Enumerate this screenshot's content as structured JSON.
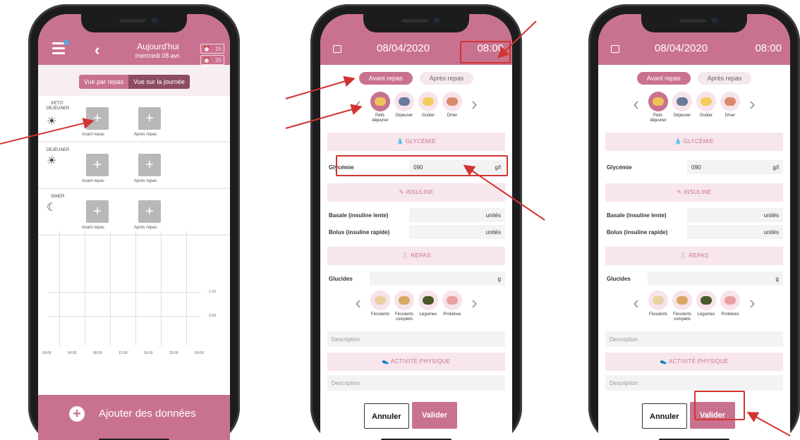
{
  "screen1": {
    "header": {
      "title": "Aujourd'hui",
      "subtitle": "mercredi 08 avr.",
      "alarm1": "1h",
      "alarm2": "2h"
    },
    "view_toggle": {
      "per_meal": "Vue par repas",
      "day": "Vue sur la journée"
    },
    "meals": [
      {
        "label": "PETIT-DEJEUNER",
        "icon": "sunrise-icon",
        "before": "Avant repas",
        "after": "Après repas"
      },
      {
        "label": "DEJEUNER",
        "icon": "sun-icon",
        "before": "Avant repas",
        "after": "Après repas"
      },
      {
        "label": "DINER",
        "icon": "moon-icon",
        "before": "Avant repas",
        "after": "Après repas"
      }
    ],
    "chart": {
      "y_ticks": [
        "1,10",
        "0,59"
      ],
      "x_ticks": [
        "00:00",
        "04:00",
        "08:00",
        "12:00",
        "16:00",
        "20:00",
        "00:00"
      ]
    },
    "add_button": "Ajouter des données"
  },
  "form": {
    "date": "08/04/2020",
    "time": "08:00",
    "tab_before": "Avant repas",
    "tab_after": "Après repas",
    "meals": [
      "Petit-déjeuner",
      "Déjeuner",
      "Goûter",
      "Dîner"
    ],
    "glycemia_section": "GLYCÉMIE",
    "glycemia_label": "Glycémie",
    "glycemia_value": "090",
    "glycemia_unit": "g/l",
    "insulin_section": "INSULINE",
    "basal_label": "Basale (insuline lente)",
    "bolus_label": "Bolus (insuline rapide)",
    "unit_units": "unités",
    "meal_section": "REPAS",
    "carbs_label": "Glucides",
    "carbs_unit": "g",
    "foods": [
      "Féculents",
      "Féculents complets",
      "Légumes",
      "Protéines"
    ],
    "description_placeholder": "Description",
    "activity_section": "ACTIVITÉ PHYSIQUE",
    "cancel": "Annuler",
    "validate": "Valider"
  },
  "colors": {
    "brand": "#c9728f",
    "annotation": "#d23431"
  }
}
